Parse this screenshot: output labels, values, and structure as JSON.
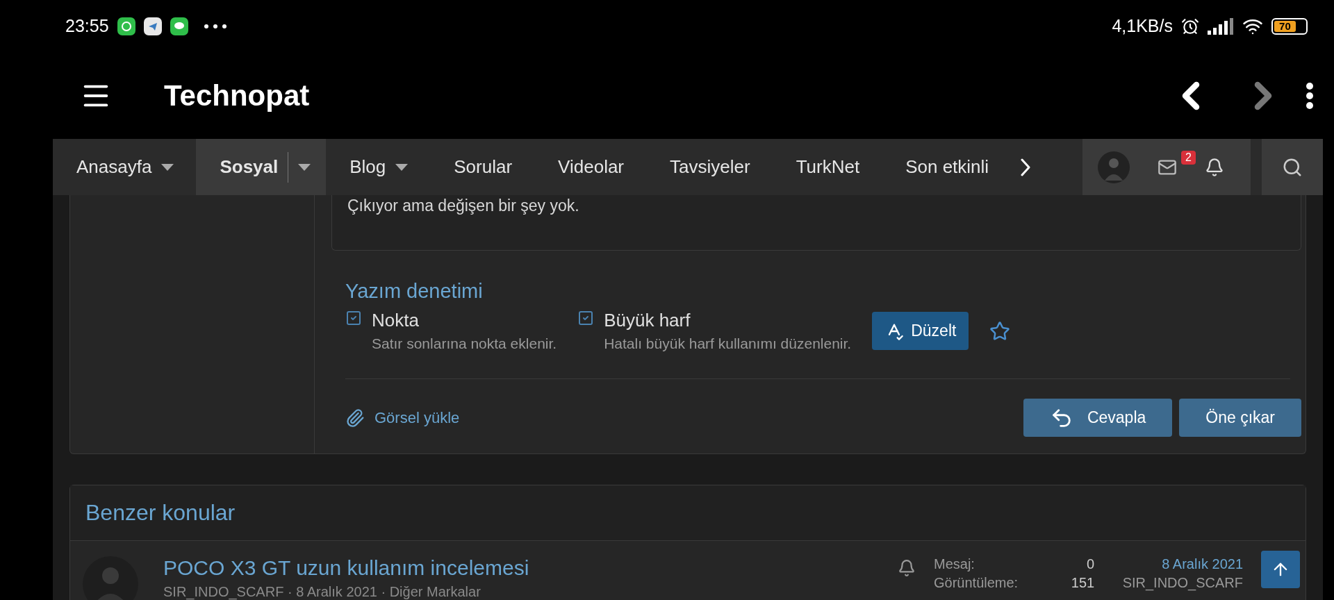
{
  "status_bar": {
    "time": "23:55",
    "speed": "4,1KB/s",
    "battery": "70"
  },
  "app_bar": {
    "title": "Technopat"
  },
  "nav": {
    "items": [
      {
        "label": "Anasayfa",
        "selected": false,
        "dropdown": true
      },
      {
        "label": "Sosyal",
        "selected": true,
        "dropdown": true
      },
      {
        "label": "Blog",
        "selected": false,
        "dropdown": true
      },
      {
        "label": "Sorular",
        "selected": false,
        "dropdown": false
      },
      {
        "label": "Videolar",
        "selected": false,
        "dropdown": false
      },
      {
        "label": "Tavsiyeler",
        "selected": false,
        "dropdown": false
      },
      {
        "label": "TurkNet",
        "selected": false,
        "dropdown": false
      },
      {
        "label": "Son etkinli",
        "selected": false,
        "dropdown": false
      }
    ],
    "notification_count": "2"
  },
  "editor": {
    "text": "Çıkıyor ama değişen bir şey yok.",
    "spellcheck": {
      "title": "Yazım denetimi",
      "options": [
        {
          "label": "Nokta",
          "description": "Satır sonlarına nokta eklenir.",
          "checked": true
        },
        {
          "label": "Büyük harf",
          "description": "Hatalı büyük harf kullanımı düzenlenir.",
          "checked": true
        }
      ],
      "fix_button": "Düzelt"
    },
    "upload": "Görsel yükle",
    "buttons": [
      {
        "label": "Cevapla",
        "kind": "reply"
      },
      {
        "label": "Öne çıkar",
        "kind": "plain"
      }
    ]
  },
  "similar": {
    "title": "Benzer konular",
    "threads": [
      {
        "title": "POCO X3 GT uzun kullanım incelemesi",
        "meta": "SIR_INDO_SCARF · 8 Aralık 2021 · Diğer Markalar",
        "stats": [
          {
            "label": "Mesaj:",
            "value": "0"
          },
          {
            "label": "Görüntüleme:",
            "value": "151"
          }
        ],
        "last_date": "8 Aralık 2021",
        "last_user": "SIR_INDO_SCARF"
      }
    ]
  }
}
